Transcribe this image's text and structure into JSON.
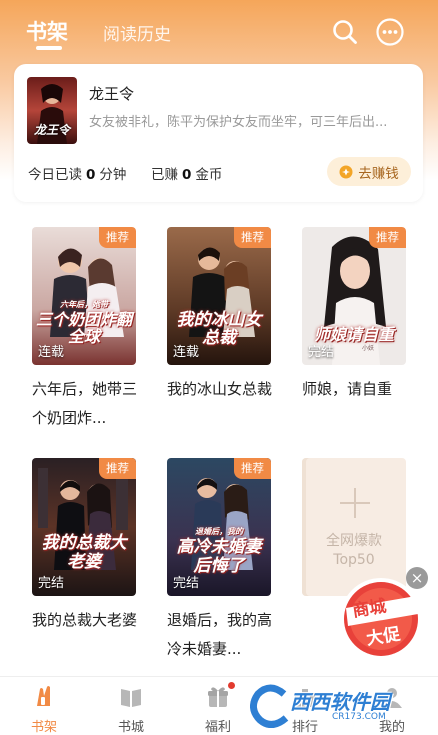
{
  "header": {
    "tab_active": "书架",
    "tab_inactive": "阅读历史"
  },
  "current_book": {
    "title": "龙王令",
    "description": "女友被非礼，陈平为保护女友而坐牢，可三年后出...",
    "cover_text": "龙王令",
    "read_prefix": "今日已读",
    "read_minutes": "0",
    "read_unit": "分钟",
    "earn_prefix": "已赚",
    "earn_coins": "0",
    "earn_unit": "金币",
    "earn_button": "去赚钱"
  },
  "books": [
    {
      "title": "六年后，她带三个奶团炸...",
      "tag": "推荐",
      "status": "连载",
      "cover_text": "三个奶团炸翻全球",
      "cover_small": "六年后，她带"
    },
    {
      "title": "我的冰山女总裁",
      "tag": "推荐",
      "status": "连载",
      "cover_text": "我的冰山女总裁",
      "cover_small": ""
    },
    {
      "title": "师娘，请自重",
      "tag": "推荐",
      "status": "完结",
      "cover_text": "师娘请自重",
      "cover_small": "小妖"
    },
    {
      "title": "我的总裁大老婆",
      "tag": "推荐",
      "status": "完结",
      "cover_text": "我的总裁大老婆",
      "cover_small": ""
    },
    {
      "title": "退婚后，我的高冷未婚妻...",
      "tag": "推荐",
      "status": "完结",
      "cover_text": "高冷未婚妻后悔了",
      "cover_small": "退婚后，我的"
    }
  ],
  "top50": {
    "line1": "全网爆款",
    "line2": "Top50"
  },
  "promo": {
    "line1": "商城",
    "line2": "大促"
  },
  "nav": [
    {
      "label": "书架",
      "icon": "bookshelf-icon",
      "active": true
    },
    {
      "label": "书城",
      "icon": "book-icon",
      "active": false
    },
    {
      "label": "福利",
      "icon": "gift-icon",
      "active": false
    },
    {
      "label": "排行",
      "icon": "rank-icon",
      "active": false
    },
    {
      "label": "我的",
      "icon": "user-icon",
      "active": false
    }
  ],
  "watermark": {
    "text": "西西软件园",
    "url": "CR173.COM"
  },
  "colors": {
    "accent": "#f18a45",
    "header_gradient_top": "#f5a65a",
    "coin_button_bg": "#fdefd9"
  }
}
